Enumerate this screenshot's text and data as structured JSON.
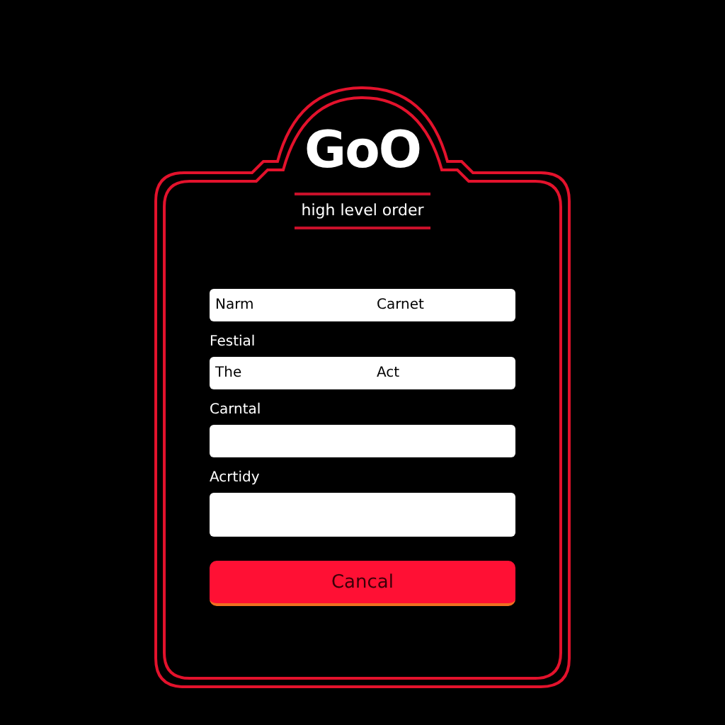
{
  "logo": "GoO",
  "tagline": "high level order",
  "fields": [
    {
      "kind": "line",
      "value": "Narm",
      "value_2": "Carnet"
    },
    {
      "kind": "line",
      "label": "Festial",
      "value": "The",
      "value_2": "Act"
    },
    {
      "kind": "line",
      "label": "Carntal"
    },
    {
      "kind": "area",
      "label": "Acrtidy"
    }
  ],
  "button": "Cancal"
}
